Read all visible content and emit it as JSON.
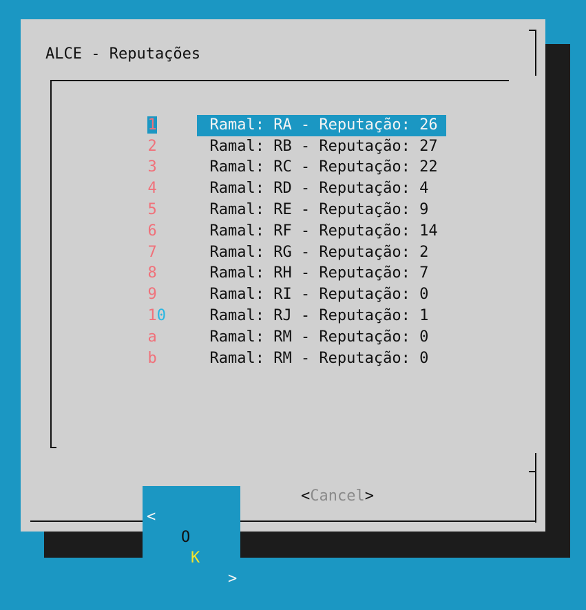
{
  "dialog": {
    "title": "ALCE - Reputações"
  },
  "list": {
    "items": [
      {
        "key": "1",
        "label": "Ramal: RA - Reputação: 26",
        "selected": true
      },
      {
        "key": "2",
        "label": "Ramal: RB - Reputação: 27"
      },
      {
        "key": "3",
        "label": "Ramal: RC - Reputação: 22"
      },
      {
        "key": "4",
        "label": "Ramal: RD - Reputação: 4"
      },
      {
        "key": "5",
        "label": "Ramal: RE - Reputação: 9"
      },
      {
        "key": "6",
        "label": "Ramal: RF - Reputação: 14"
      },
      {
        "key": "7",
        "label": "Ramal: RG - Reputação: 2"
      },
      {
        "key": "8",
        "label": "Ramal: RH - Reputação: 7"
      },
      {
        "key": "9",
        "label": "Ramal: RI - Reputação: 0"
      },
      {
        "key": "10",
        "key_first": "1",
        "key_rest": "0",
        "label": "Ramal: RJ - Reputação: 1"
      },
      {
        "key": "a",
        "label": "Ramal: RM - Reputação: 0"
      },
      {
        "key": "b",
        "label": "Ramal: RM - Reputação: 0"
      }
    ]
  },
  "buttons": {
    "ok": {
      "left": "<",
      "o": "O",
      "k": "K",
      "right": ">"
    },
    "cancel": {
      "open": "<",
      "label": "Cancel",
      "close": ">"
    }
  },
  "colors": {
    "background": "#1b97c3",
    "dialog": "#d0d0d0",
    "highlight": "#1b97c3",
    "hotkey": "#f0717a",
    "hotkey_alt": "#29b6e2",
    "ok_hotkey": "#f3e62c"
  }
}
